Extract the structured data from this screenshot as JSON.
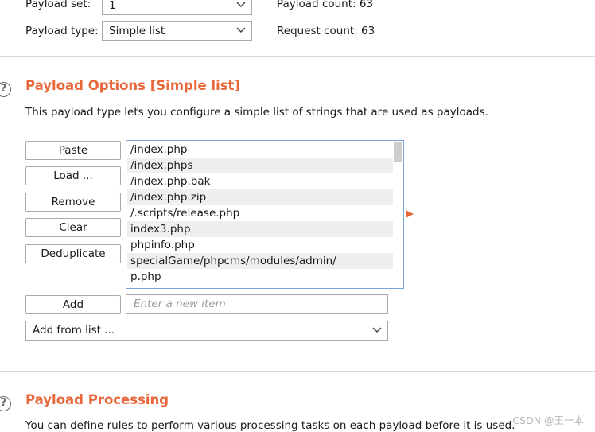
{
  "payload_sets": {
    "set_label": "Payload set:",
    "set_value": "1",
    "type_label": "Payload type:",
    "type_value": "Simple list",
    "payload_count": "Payload count: 63",
    "request_count": "Request count: 63"
  },
  "options": {
    "title": "Payload Options [Simple list]",
    "description": "This payload type lets you configure a simple list of strings that are used as payloads.",
    "buttons": {
      "paste": "Paste",
      "load": "Load ...",
      "remove": "Remove",
      "clear": "Clear",
      "deduplicate": "Deduplicate",
      "add": "Add"
    },
    "items": [
      "/index.php",
      "/index.phps",
      "/index.php.bak",
      "/index.php.zip",
      "/.scripts/release.php",
      "index3.php",
      "phpinfo.php",
      "specialGame/phpcms/modules/admin/",
      "p.php"
    ],
    "new_item_placeholder": "Enter a new item",
    "add_from_list": "Add from list ..."
  },
  "processing": {
    "title": "Payload Processing",
    "description": "You can define rules to perform various processing tasks on each payload before it is used."
  },
  "help_glyph": "?",
  "watermark": "CSDN @王一本",
  "colors": {
    "accent": "#e8673a",
    "list_border": "#7aa7d9",
    "alt_row": "#efefef"
  }
}
